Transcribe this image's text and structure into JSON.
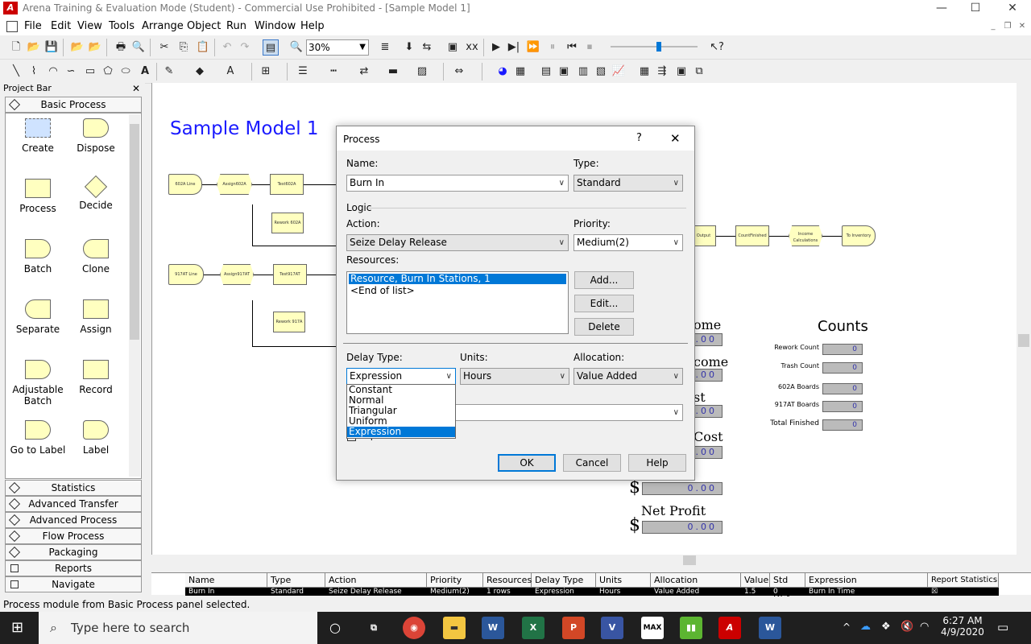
{
  "window": {
    "title": "Arena Training & Evaluation Mode (Student) - Commercial Use Prohibited - [Sample Model 1]",
    "controls": [
      "—",
      "☐",
      "✕"
    ]
  },
  "menu": [
    "File",
    "Edit",
    "View",
    "Tools",
    "Arrange",
    "Object",
    "Run",
    "Window",
    "Help"
  ],
  "toolbar": {
    "zoom": "30%"
  },
  "project_bar": {
    "title": "Project Bar",
    "active_panel": "Basic Process",
    "modules": [
      {
        "label": "Create"
      },
      {
        "label": "Dispose"
      },
      {
        "label": "Process"
      },
      {
        "label": "Decide"
      },
      {
        "label": "Batch"
      },
      {
        "label": "Clone"
      },
      {
        "label": "Separate"
      },
      {
        "label": "Assign"
      },
      {
        "label": "Adjustable Batch"
      },
      {
        "label": "Record"
      },
      {
        "label": "Go to Label"
      },
      {
        "label": "Label"
      }
    ],
    "panels": [
      "Statistics",
      "Advanced Transfer",
      "Advanced Process",
      "Flow Process",
      "Packaging",
      "Reports",
      "Navigate"
    ]
  },
  "canvas": {
    "title": "Sample Model 1",
    "nodes": [
      "602A Line",
      "Assign602A",
      "Test602A",
      "Rework 602A",
      "917AT Line",
      "Assign917AT",
      "Test917AT",
      "Rework 917A",
      "Output",
      "CountFinished",
      "Income Calculations",
      "To Inventory"
    ],
    "labels": {
      "income": "ome",
      "outcome": "come",
      "cost": "st",
      "total_cost": "Cost",
      "net_profit": "Net Profit"
    },
    "value": "0.00",
    "dollar": "$",
    "counts": {
      "title": "Counts",
      "items": [
        {
          "label": "Rework Count",
          "value": "0"
        },
        {
          "label": "Trash Count",
          "value": "0"
        },
        {
          "label": "602A Boards",
          "value": "0"
        },
        {
          "label": "917AT Boards",
          "value": "0"
        },
        {
          "label": "Total Finished",
          "value": "0"
        }
      ]
    }
  },
  "dialog": {
    "title": "Process",
    "help": "?",
    "close": "✕",
    "name_label": "Name:",
    "name": "Burn In",
    "type_label": "Type:",
    "type": "Standard",
    "logic_label": "Logic",
    "action_label": "Action:",
    "action": "Seize Delay Release",
    "priority_label": "Priority:",
    "priority": "Medium(2)",
    "resources_label": "Resources:",
    "resources": [
      "Resource, Burn In Stations, 1",
      "<End of list>"
    ],
    "add": "Add...",
    "edit": "Edit...",
    "delete": "Delete",
    "delay_label": "Delay Type:",
    "delay": "Expression",
    "units_label": "Units:",
    "units": "Hours",
    "alloc_label": "Allocation:",
    "alloc": "Value Added",
    "delay_options": [
      "Constant",
      "Normal",
      "Triangular",
      "Uniform",
      "Expression"
    ],
    "report_stats": "Report Statistics",
    "ok": "OK",
    "cancel": "Cancel",
    "help_btn": "Help"
  },
  "grid": {
    "headers": [
      "Name",
      "Type",
      "Action",
      "Priority",
      "Resources",
      "Delay Type",
      "Units",
      "Allocation",
      "Value",
      "Std Dev",
      "Expression",
      "Report Statistics"
    ],
    "row": [
      "Burn In",
      "Standard",
      "Seize Delay Release",
      "Medium(2)",
      "1 rows",
      "Expression",
      "Hours",
      "Value Added",
      "1.5",
      "0",
      "Burn In Time",
      "☒"
    ]
  },
  "status": "Process module from Basic Process panel selected.",
  "taskbar": {
    "search": "Type here to search",
    "time": "6:27 AM",
    "date": "4/9/2020"
  }
}
